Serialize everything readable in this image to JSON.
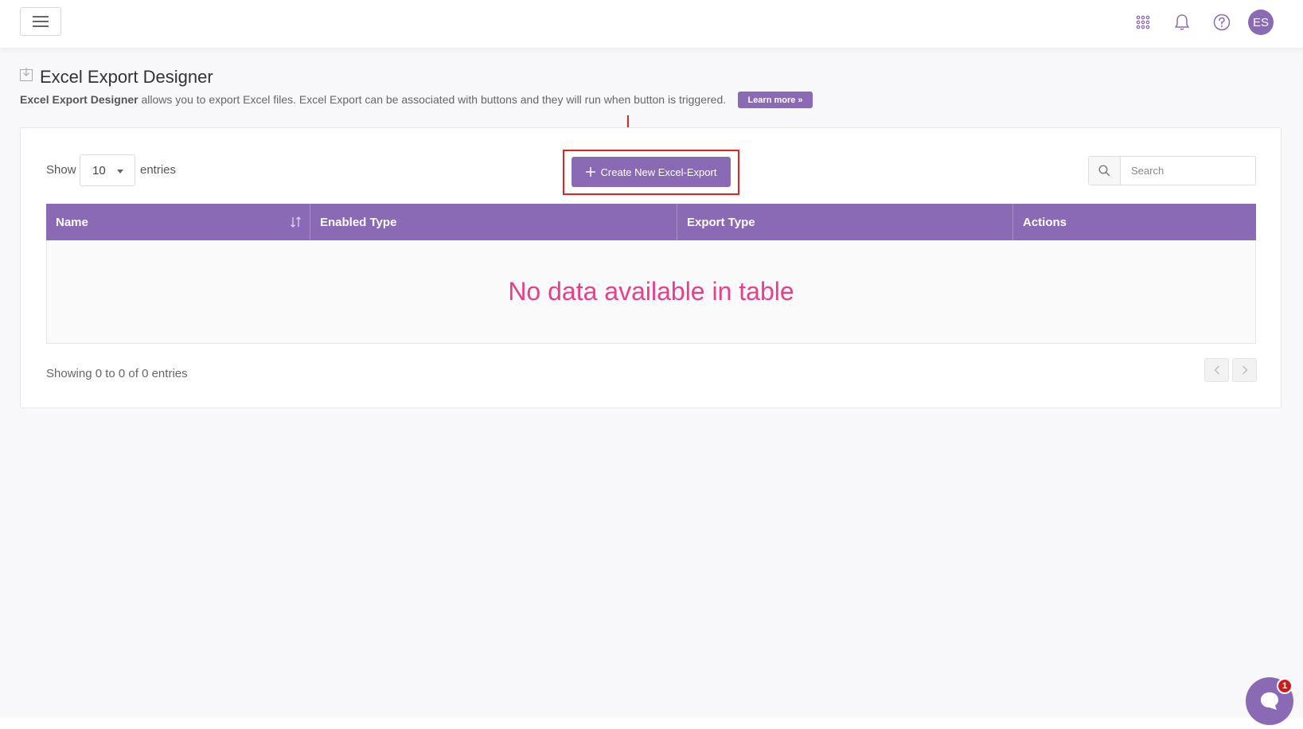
{
  "header": {
    "avatar_initials": "ES",
    "icons": [
      "menu-icon",
      "apps-grid-icon",
      "bell-icon",
      "help-icon"
    ]
  },
  "page": {
    "title": "Excel Export Designer",
    "desc_bold": "Excel Export Designer",
    "desc_rest": " allows you to export Excel files. Excel Export can be associated with buttons and they will run when button is triggered.",
    "learn_more_label": "Learn more »"
  },
  "controls": {
    "show_label": "Show",
    "entries_value": "10",
    "entries_label": "entries",
    "create_label": "Create New Excel-Export",
    "search_placeholder": "Search"
  },
  "table": {
    "columns": [
      "Name",
      "Enabled Type",
      "Export Type",
      "Actions"
    ],
    "empty_message": "No data available in table"
  },
  "footer": {
    "showing_text": "Showing 0 to 0 of 0 entries"
  },
  "chat": {
    "badge_count": "1"
  },
  "colors": {
    "accent": "#8b6ab5",
    "empty_text": "#e83e8c",
    "highlight": "#e02424"
  }
}
